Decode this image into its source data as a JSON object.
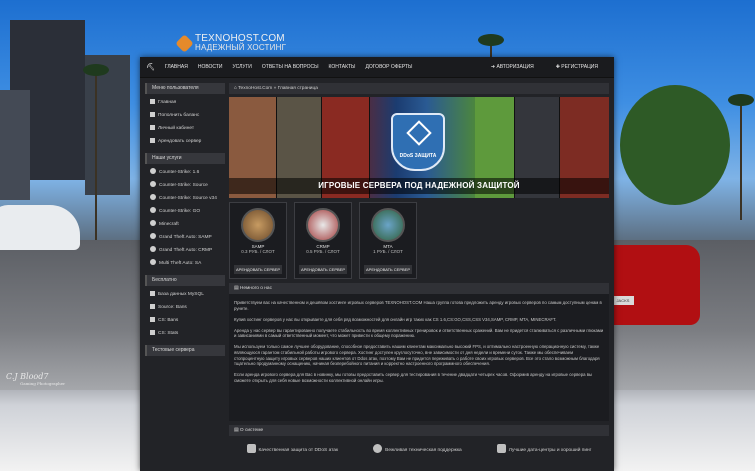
{
  "logo": {
    "title": "TEXNOHOST.COM",
    "subtitle": "НАДЕЖНЫЙ ХОСТИНГ"
  },
  "nav": {
    "items": [
      "ГЛАВНАЯ",
      "НОВОСТИ",
      "УСЛУГИ",
      "ОТВЕТЫ НА ВОПРОСЫ",
      "КОНТАКТЫ",
      "ДОГОВОР ОФЕРТЫ"
    ],
    "login": "АВТОРИЗАЦИЯ",
    "register": "РЕГИСТРАЦИЯ"
  },
  "sidebar": {
    "user_menu": {
      "title": "Меню пользователя",
      "items": [
        "Главная",
        "Пополнить баланс",
        "Личный кабинет",
        "Арендовать сервер"
      ]
    },
    "services": {
      "title": "Наши услуги",
      "items": [
        "Counter-Strike: 1.6",
        "Counter-Strike: Source",
        "Counter-Strike: Source v34",
        "Counter-Strike: GO",
        "Minecraft",
        "Grand Theft Auto: SAMP",
        "Grand Theft Auto: CRMP",
        "Multi Theft Auto: SA"
      ]
    },
    "free": {
      "title": "Бесплатно",
      "items": [
        "База данных MySQL",
        "Source: Bans",
        "CS: Bans",
        "CS: Stats"
      ]
    },
    "test": {
      "title": "Тестовые сервера"
    }
  },
  "breadcrumb": "TexnoHost.Com » Главная страница",
  "banner": {
    "title": "ИГРОВЫЕ СЕРВЕРА ПОД НАДЕЖНОЙ ЗАЩИТОЙ",
    "badge": "DDoS ЗАЩИТА"
  },
  "cards": [
    {
      "name": "SAMP",
      "price": "0.3 РУБ. / СЛОТ",
      "button": "АРЕНДОВАТЬ СЕРВЕР"
    },
    {
      "name": "CRMP",
      "price": "0.5 РУБ. / СЛОТ",
      "button": "АРЕНДОВАТЬ СЕРВЕР"
    },
    {
      "name": "MTA",
      "price": "1 РУБ. / СЛОТ",
      "button": "АРЕНДОВАТЬ СЕРВЕР"
    }
  ],
  "about": {
    "title": "Немного о нас",
    "paragraphs": [
      "Приветствуем вас на качественном и дешёвом хостинге игровых серверов TEXNOHOST.COM Наша группа готова предложить аренду игровых серверов по самым доступным ценам в рунете.",
      "Купив хостинг серверов у нас вы открываете для себя ряд возможностей для онлайн игр таких как CS 1.6,CS:GO,CSS,CSS V34,SAMP, CRMP, MTA, MINECRAFT.",
      "Аренда у нас сервер вы гарантированно получаете стабильность во время коллективных тренировок и ответственных сражений. Вам не придется сталкиваться с различными глюками и зависаниями в самый ответственный момент, что может привести к общему поражению.",
      "Мы используем только самое лучшее оборудование, способное предоставить нашим клиентам максимально высокий FPS, и оптимально настроенную операционную систему, также являющуюся гарантом стабильной работы игрового сервера. Хостинг доступен круглосуточно, вне зависимости от дня недели и времени суток. Также мы обеспечиваем стопроцентную защиту игровых серверов наших клиентов от Ddos атак, поэтому Вам не придется переживать о работе своих игровых серверов. Все это стало возможным благодаря тщательно продуманному оснащению, начиная безперебойного питания и корректно настроенного программного обеспечения.",
      "Если аренда игрового сервера для Вас в новинку, мы готовы предоставить сервер для тестирования в течение двадцати четырех часов. Оформив аренду на игровые сервера вы сможете открыть для себя новые возможности коллективной онлайн игры."
    ]
  },
  "system": {
    "title": "О системе",
    "features": [
      "Качественная защита от DDoS атак",
      "Вежливая техническая поддержка",
      "Лучшие дата-центры и хороший пинг"
    ]
  },
  "watermark": {
    "name": "C.J Blood7",
    "caption": "Gaming Photographer"
  },
  "colors": {
    "accent": "#e58a2b",
    "panel": "#222327",
    "nav": "#1a1b1e",
    "badge": "#2f6fb3"
  }
}
